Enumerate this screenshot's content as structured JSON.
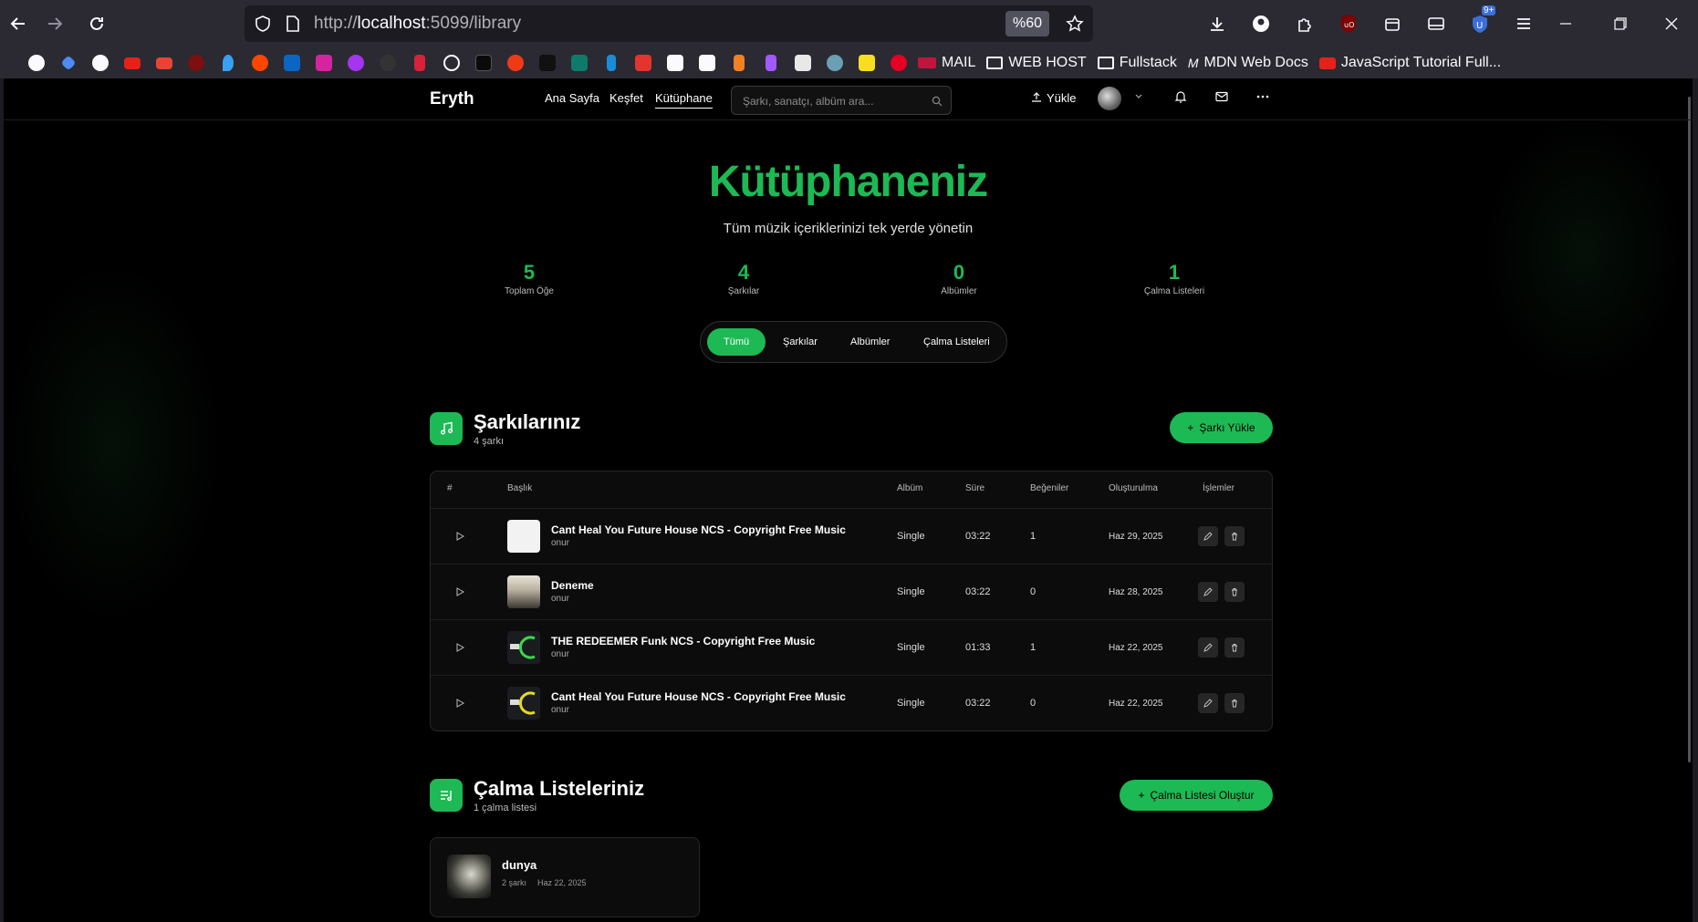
{
  "browser": {
    "url_prefix": "http://",
    "url_host": "localhost",
    "url_rest": ":5099/library",
    "zoom": "%60",
    "ext_badge": "9+",
    "bookmarks": [
      {
        "label": "MAIL"
      },
      {
        "label": "WEB HOST"
      },
      {
        "label": "Fullstack"
      },
      {
        "label": "MDN Web Docs"
      },
      {
        "label": "JavaScript Tutorial Full..."
      }
    ]
  },
  "header": {
    "brand": "Eryth",
    "nav": [
      "Ana Sayfa",
      "Keşfet",
      "Kütüphane"
    ],
    "search_placeholder": "Şarkı, sanatçı, albüm ara...",
    "upload_label": "Yükle"
  },
  "hero": {
    "title": "Kütüphaneniz",
    "subtitle": "Tüm müzik içeriklerinizi tek yerde yönetin"
  },
  "stats": [
    {
      "value": "5",
      "label": "Toplam Öğe"
    },
    {
      "value": "4",
      "label": "Şarkılar"
    },
    {
      "value": "0",
      "label": "Albümler"
    },
    {
      "value": "1",
      "label": "Çalma Listeleri"
    }
  ],
  "filter_tabs": [
    "Tümü",
    "Şarkılar",
    "Albümler",
    "Çalma Listeleri"
  ],
  "songs_section": {
    "title": "Şarkılarınız",
    "subtitle": "4 şarkı",
    "button": "Şarkı Yükle",
    "columns": [
      "#",
      "Başlık",
      "Albüm",
      "Süre",
      "Beğeniler",
      "Oluşturulma",
      "İşlemler"
    ],
    "rows": [
      {
        "title": "Cant Heal You Future House NCS - Copyright Free Music",
        "artist": "onur",
        "album": "Single",
        "duration": "03:22",
        "likes": "1",
        "created": "Haz 29, 2025"
      },
      {
        "title": "Deneme",
        "artist": "onur",
        "album": "Single",
        "duration": "03:22",
        "likes": "0",
        "created": "Haz 28, 2025"
      },
      {
        "title": "THE REDEEMER Funk NCS - Copyright Free Music",
        "artist": "onur",
        "album": "Single",
        "duration": "01:33",
        "likes": "1",
        "created": "Haz 22, 2025"
      },
      {
        "title": "Cant Heal You Future House NCS - Copyright Free Music",
        "artist": "onur",
        "album": "Single",
        "duration": "03:22",
        "likes": "0",
        "created": "Haz 22, 2025"
      }
    ]
  },
  "playlists_section": {
    "title": "Çalma Listeleriniz",
    "subtitle": "1 çalma listesi",
    "button": "Çalma Listesi Oluştur",
    "items": [
      {
        "name": "dunya",
        "count": "2 şarkı",
        "date": "Haz 22, 2025"
      }
    ]
  },
  "colors": {
    "accent": "#1db954",
    "background": "#000000"
  }
}
